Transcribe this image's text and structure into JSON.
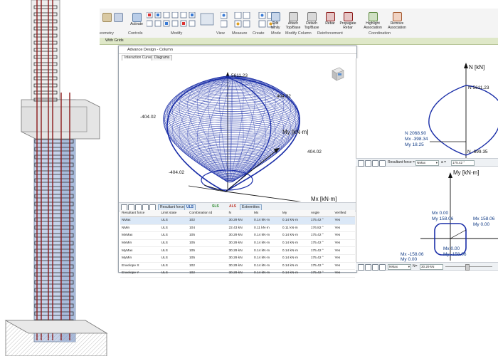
{
  "ribbon": {
    "buttons": [
      {
        "label": "Activate",
        "icon": "activate-icon"
      },
      {
        "label": "Edit\nfamily",
        "icon": "edit-family-icon"
      },
      {
        "label": "Attach\nTop/Base",
        "icon": "attach-icon"
      },
      {
        "label": "Detach\nTop/Base",
        "icon": "detach-icon"
      },
      {
        "label": "Rebar",
        "icon": "rebar-icon"
      },
      {
        "label": "Propagate\nRebar",
        "icon": "propagate-rebar-icon"
      },
      {
        "label": "Highlight\nAssociation",
        "icon": "highlight-association-icon"
      },
      {
        "label": "Remove\nAssociation",
        "icon": "remove-association-icon"
      }
    ],
    "groups": [
      "eometry",
      "Controls",
      "Modify",
      "View",
      "Measure",
      "Create",
      "Mode",
      "Modify Column",
      "Reinforcement",
      "Coordination"
    ],
    "context_bar": "With Grids"
  },
  "dialog": {
    "title": "Advance Design - Column",
    "tabs": [
      "Interaction Curves",
      "Diagrams"
    ],
    "plot3d": {
      "top_value": "5611.23",
      "left_value": "-404.02",
      "right_value": "404.02",
      "right_bottom_value": "404.02",
      "left_bottom_value": "-404.02",
      "my_axis": "My [kN·m]",
      "mx_axis": "Mx [kN·m]"
    },
    "toolbar": {
      "resultant_forces": "Resultant forces",
      "uls": "ULS",
      "sls": "SLS",
      "als": "ALS",
      "extremities": "Extremities"
    },
    "table": {
      "headers": [
        "Resultant force",
        "Limit state",
        "Combination Id",
        "N",
        "Mx",
        "My",
        "Angle",
        "Verified"
      ],
      "rows": [
        [
          "NMax",
          "ULS",
          "102",
          "30.29 kN",
          "0.14 kN·m",
          "0.14 kN·m",
          "175.42 °",
          "Yes"
        ],
        [
          "NMin",
          "ULS",
          "104",
          "22.43 kN",
          "0.11 kN·m",
          "0.11 kN·m",
          "176.82 °",
          "Yes"
        ],
        [
          "MxMax",
          "ULS",
          "105",
          "30.29 kN",
          "0.14 kN·m",
          "0.14 kN·m",
          "175.42 °",
          "Yes"
        ],
        [
          "MxMin",
          "ULS",
          "105",
          "30.29 kN",
          "0.14 kN·m",
          "0.14 kN·m",
          "175.42 °",
          "Yes"
        ],
        [
          "MyMax",
          "ULS",
          "105",
          "30.29 kN",
          "0.14 kN·m",
          "0.14 kN·m",
          "175.42 °",
          "Yes"
        ],
        [
          "MyMin",
          "ULS",
          "105",
          "30.29 kN",
          "0.14 kN·m",
          "0.14 kN·m",
          "175.42 °",
          "Yes"
        ],
        [
          "Envelope X",
          "ULS",
          "102",
          "30.29 kN",
          "0.14 kN·m",
          "0.14 kN·m",
          "175.42 °",
          "Yes"
        ],
        [
          "Envelope Y",
          "ULS",
          "102",
          "30.29 kN",
          "0.14 kN·m",
          "0.14 kN·m",
          "175.42 °",
          "Yes"
        ]
      ]
    }
  },
  "right_top": {
    "axis": "N [kN]",
    "top_label": "N 5611.23",
    "point_n": "N 2068.90",
    "point_mx": "Mx -398.34",
    "point_my": "My 18.25",
    "bottom_label": "N -699.35",
    "toolbar_label": "Resultant force =",
    "select_value": "NMax",
    "alpha_label": "a =",
    "alpha_value": "175.42 °"
  },
  "right_bottom": {
    "axis": "My [kN·m]",
    "top_mx": "Mx 0.00",
    "top_my": "My 158.06",
    "right_mx": "Mx 158.06",
    "right_my": "My 0.00",
    "left_mx": "Mx -158.06",
    "left_my": "My 0.00",
    "bottom_mx": "Mx 0.00",
    "bottom_my": "My -158.06",
    "select_value": "NMax",
    "n_label": "N=",
    "n_value": "30.29 kN"
  }
}
